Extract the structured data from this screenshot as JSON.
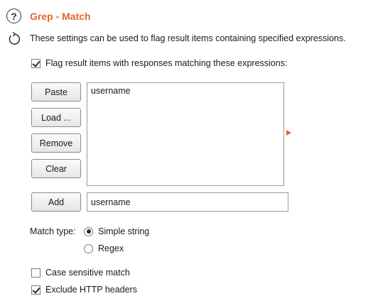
{
  "header": {
    "title": "Grep - Match",
    "description": "These settings can be used to flag result items containing specified expressions.",
    "help_icon": "help-icon",
    "refresh_icon": "refresh-icon",
    "title_color": "#e8642a"
  },
  "flag_checkbox": {
    "label": "Flag result items with responses matching these expressions:",
    "checked": true
  },
  "list_buttons": {
    "paste": "Paste",
    "load": "Load ...",
    "remove": "Remove",
    "clear": "Clear"
  },
  "expressions": [
    "username"
  ],
  "add_row": {
    "button": "Add",
    "value": "username"
  },
  "match_type": {
    "label": "Match type:",
    "options": [
      "Simple string",
      "Regex"
    ],
    "selected": "Simple string"
  },
  "case_sensitive": {
    "label": "Case sensitive match",
    "checked": false
  },
  "exclude_headers": {
    "label": "Exclude HTTP headers",
    "checked": true
  }
}
